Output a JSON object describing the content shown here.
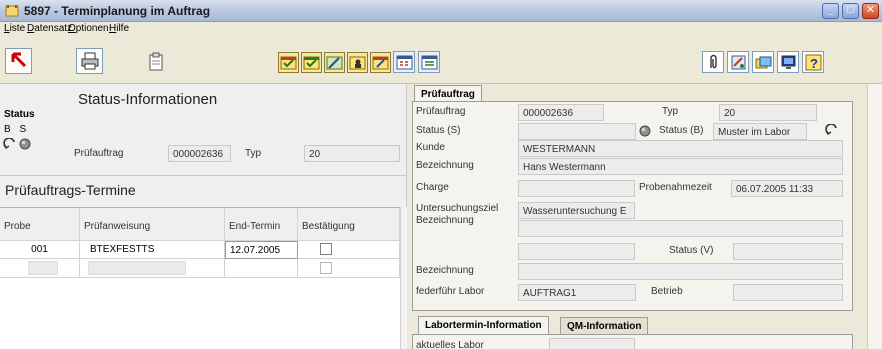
{
  "window": {
    "title": "5897 - Terminplanung im Auftrag"
  },
  "menu": [
    "Liste",
    "Datensatz",
    "Optionen",
    "Hilfe"
  ],
  "status_panel": {
    "heading": "Status-Informationen",
    "status_label": "Status",
    "bs_label": "B S",
    "pruefauftrag_label": "Prüfauftrag",
    "pruefauftrag_value": "000002636",
    "typ_label": "Typ",
    "typ_value": "20"
  },
  "termine": {
    "heading": "Prüfauftrags-Termine",
    "columns": [
      "Probe",
      "Prüfanweisung",
      "End-Termin",
      "Bestätigung"
    ],
    "rows": [
      {
        "probe": "001",
        "pruefanweisung": "BTEXFESTTS",
        "end_termin": "12.07.2005",
        "bestaetigung": false
      }
    ]
  },
  "tabs": {
    "main": "Prüfauftrag",
    "lower": [
      "Labortermin-Information",
      "QM-Information"
    ]
  },
  "form": {
    "pruefauftrag_label": "Prüfauftrag",
    "pruefauftrag_value": "000002636",
    "typ_label": "Typ",
    "typ_value": "20",
    "status_s_label": "Status (S)",
    "status_s_value": "",
    "status_b_label": "Status (B)",
    "status_b_value": "Muster im Labor",
    "kunde_label": "Kunde",
    "kunde_value": "WESTERMANN",
    "bezeichnung1_label": "Bezeichnung",
    "bezeichnung1_value": "Hans Westermann",
    "charge_label": "Charge",
    "charge_value": "",
    "probenahmezeit_label": "Probenahmezeit",
    "probenahmezeit_value": "06.07.2005 11:33",
    "untersuchungsziel_label": "Untersuchungsziel",
    "untersuchungsziel_value": "Wasseruntersuchung E",
    "bezeichnung2_label": "Bezeichnung",
    "status_v_label": "Status (V)",
    "bezeichnung3_label": "Bezeichnung",
    "federfuehr_label": "federführ Labor",
    "federfuehr_value": "AUFTRAG1",
    "betrieb_label": "Betrieb",
    "betrieb_value": "",
    "aktuelles_labor_label": "aktuelles Labor"
  }
}
